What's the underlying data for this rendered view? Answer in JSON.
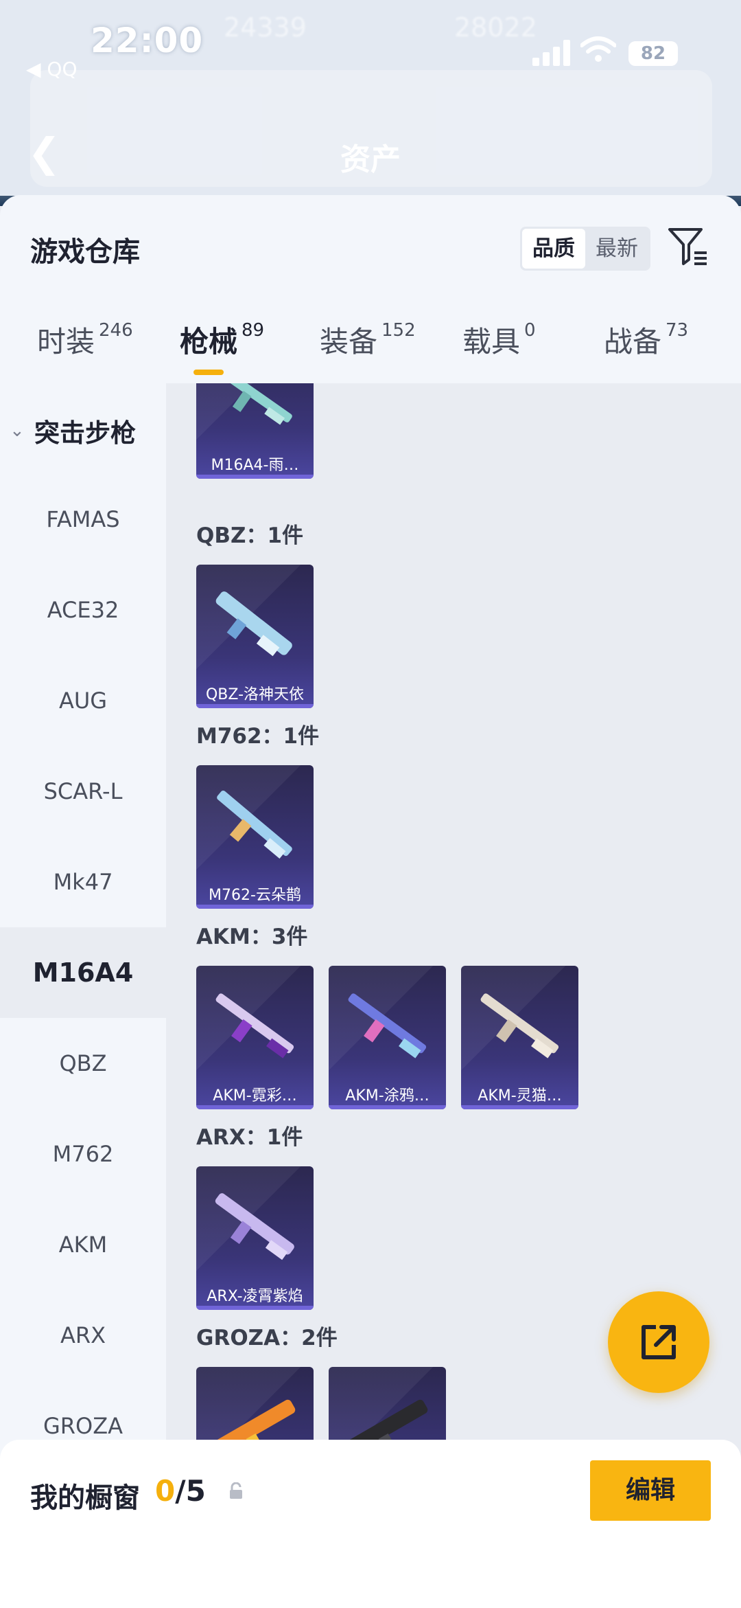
{
  "status_bar": {
    "time": "22:00",
    "back_app": "◀ QQ",
    "battery": "82"
  },
  "background": {
    "ghost_texts": [
      "24339",
      "28022",
      "资产"
    ]
  },
  "sheet": {
    "title": "游戏仓库",
    "sort": {
      "quality": "品质",
      "newest": "最新"
    },
    "tabs": [
      {
        "label": "时装",
        "count": "246"
      },
      {
        "label": "枪械",
        "count": "89"
      },
      {
        "label": "装备",
        "count": "152"
      },
      {
        "label": "载具",
        "count": "0"
      },
      {
        "label": "战备",
        "count": "73"
      }
    ],
    "sidebar": {
      "group": "突击步枪",
      "items": [
        "FAMAS",
        "ACE32",
        "AUG",
        "SCAR-L",
        "Mk47",
        "M16A4",
        "QBZ",
        "M762",
        "AKM",
        "ARX",
        "GROZA"
      ]
    },
    "groups": [
      {
        "header": "",
        "items": [
          "M16A4-雨…"
        ]
      },
      {
        "header": "QBZ：1件",
        "items": [
          "QBZ-洛神天依"
        ]
      },
      {
        "header": "M762：1件",
        "items": [
          "M762-云朵鹊"
        ]
      },
      {
        "header": "AKM：3件",
        "items": [
          "AKM-霓彩…",
          "AKM-涂鸦…",
          "AKM-灵猫…"
        ]
      },
      {
        "header": "ARX：1件",
        "items": [
          "ARX-凌霄紫焰"
        ]
      },
      {
        "header": "GROZA：2件",
        "items": [
          "",
          ""
        ]
      }
    ]
  },
  "bottom": {
    "title": "我的橱窗",
    "current": "0",
    "total": "/5",
    "edit": "编辑"
  },
  "colors": {
    "accent": "#f9b511",
    "card": "#3a3578"
  }
}
